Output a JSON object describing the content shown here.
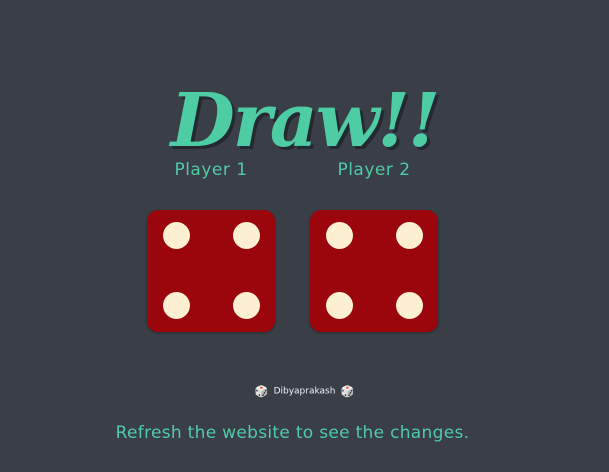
{
  "title": "Draw!!",
  "players": [
    {
      "label": "Player 1",
      "die_value": 4
    },
    {
      "label": "Player 2",
      "die_value": 4
    }
  ],
  "footer": {
    "credit_icon": "dice-icon",
    "credit_name": "Dibyaprakash",
    "message": "Refresh the website to see the changes."
  },
  "colors": {
    "background": "#393e47",
    "accent": "#4ecca3",
    "die": "#9b050c",
    "pip": "#fdf0d2"
  }
}
